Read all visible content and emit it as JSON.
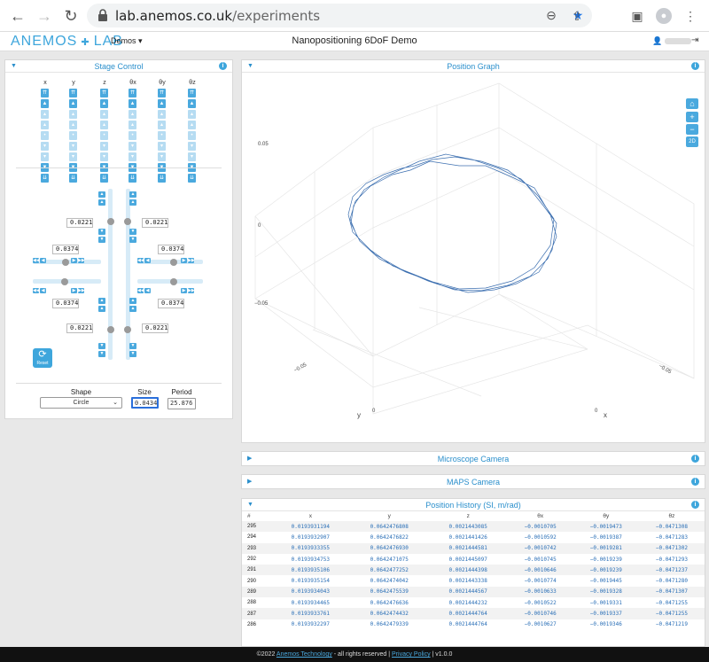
{
  "browser": {
    "url_host": "lab.anemos.co.uk",
    "url_path": "/experiments"
  },
  "app": {
    "logo_left": "ANEMOS",
    "logo_right": "LAB",
    "demos_label": "Demos",
    "title": "Nanopositioning 6DoF Demo"
  },
  "stage": {
    "title": "Stage Control",
    "axes": [
      "x",
      "y",
      "z",
      "θx",
      "θy",
      "θz"
    ],
    "values": {
      "tl": "0.0221",
      "tr": "0.0221",
      "ml": "0.0374",
      "mr": "0.0374",
      "bl1": "0.0374",
      "br1": "0.0374",
      "bl2": "0.0221",
      "br2": "0.0221"
    },
    "reset_label": "Reset",
    "shape_label": "Shape",
    "shape_value": "Circle",
    "size_label": "Size",
    "size_value": "0.0434",
    "period_label": "Period",
    "period_value": "25.876"
  },
  "graph": {
    "title": "Position Graph",
    "tick_top": "0.05",
    "tick_mid": "0",
    "tick_low": "−0.05",
    "tick_bl": "−0.05",
    "tick_br": "−0.05",
    "x_tick": "0",
    "y_tick": "0",
    "axis_y": "y",
    "axis_x": "x",
    "btn_2d": "2D"
  },
  "microscope": {
    "title": "Microscope Camera"
  },
  "maps": {
    "title": "MAPS Camera"
  },
  "history": {
    "title": "Position History (SI, m/rad)",
    "columns": [
      "#",
      "x",
      "y",
      "z",
      "θx",
      "θy",
      "θz"
    ],
    "rows": [
      [
        "295",
        "0.0193931194",
        "0.0642476808",
        "0.0021443085",
        "−0.0010705",
        "−0.0019473",
        "−0.0471308"
      ],
      [
        "294",
        "0.0193932907",
        "0.0642476822",
        "0.0021441426",
        "−0.0010592",
        "−0.0019387",
        "−0.0471283"
      ],
      [
        "293",
        "0.0193933355",
        "0.0642476930",
        "0.0021444581",
        "−0.0010742",
        "−0.0019281",
        "−0.0471302"
      ],
      [
        "292",
        "0.0193934753",
        "0.0642471075",
        "0.0021445097",
        "−0.0010745",
        "−0.0019239",
        "−0.0471293"
      ],
      [
        "291",
        "0.0193935106",
        "0.0642477252",
        "0.0021444398",
        "−0.0010646",
        "−0.0019239",
        "−0.0471237"
      ],
      [
        "290",
        "0.0193935154",
        "0.0642474042",
        "0.0021443338",
        "−0.0010774",
        "−0.0019445",
        "−0.0471280"
      ],
      [
        "289",
        "0.0193934043",
        "0.0642475539",
        "0.0021444567",
        "−0.0010633",
        "−0.0019328",
        "−0.0471307"
      ],
      [
        "288",
        "0.0193934465",
        "0.0642476636",
        "0.0021444232",
        "−0.0010522",
        "−0.0019331",
        "−0.0471255"
      ],
      [
        "287",
        "0.0193933761",
        "0.0642474432",
        "0.0021444764",
        "−0.0010746",
        "−0.0019337",
        "−0.0471255"
      ],
      [
        "286",
        "0.0193932297",
        "0.0642479339",
        "0.0021444764",
        "−0.0010627",
        "−0.0019346",
        "−0.0471219"
      ]
    ]
  },
  "footer": {
    "copyright": "©2022 ",
    "company": "Anemos Technology",
    "rights": " - all rights reserved | ",
    "privacy": "Privacy Policy",
    "version": " | v1.0.0"
  }
}
